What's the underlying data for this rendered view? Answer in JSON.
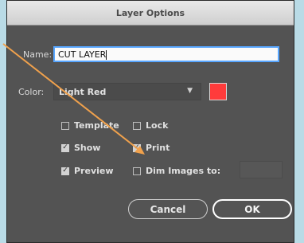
{
  "dialog": {
    "title": "Layer Options",
    "name_label": "Name:",
    "name_value": "CUT LAYER",
    "color_label": "Color:",
    "color_value": "Light Red",
    "color_swatch": "#ff3b3b",
    "checkboxes": {
      "template": {
        "label": "Template",
        "checked": false
      },
      "lock": {
        "label": "Lock",
        "checked": false
      },
      "show": {
        "label": "Show",
        "checked": true
      },
      "print": {
        "label": "Print",
        "checked": true
      },
      "preview": {
        "label": "Preview",
        "checked": true
      },
      "dim_images": {
        "label": "Dim Images to:",
        "checked": false
      }
    },
    "cancel_label": "Cancel",
    "ok_label": "OK"
  },
  "annotation": {
    "arrow_color": "#f0a14c"
  }
}
